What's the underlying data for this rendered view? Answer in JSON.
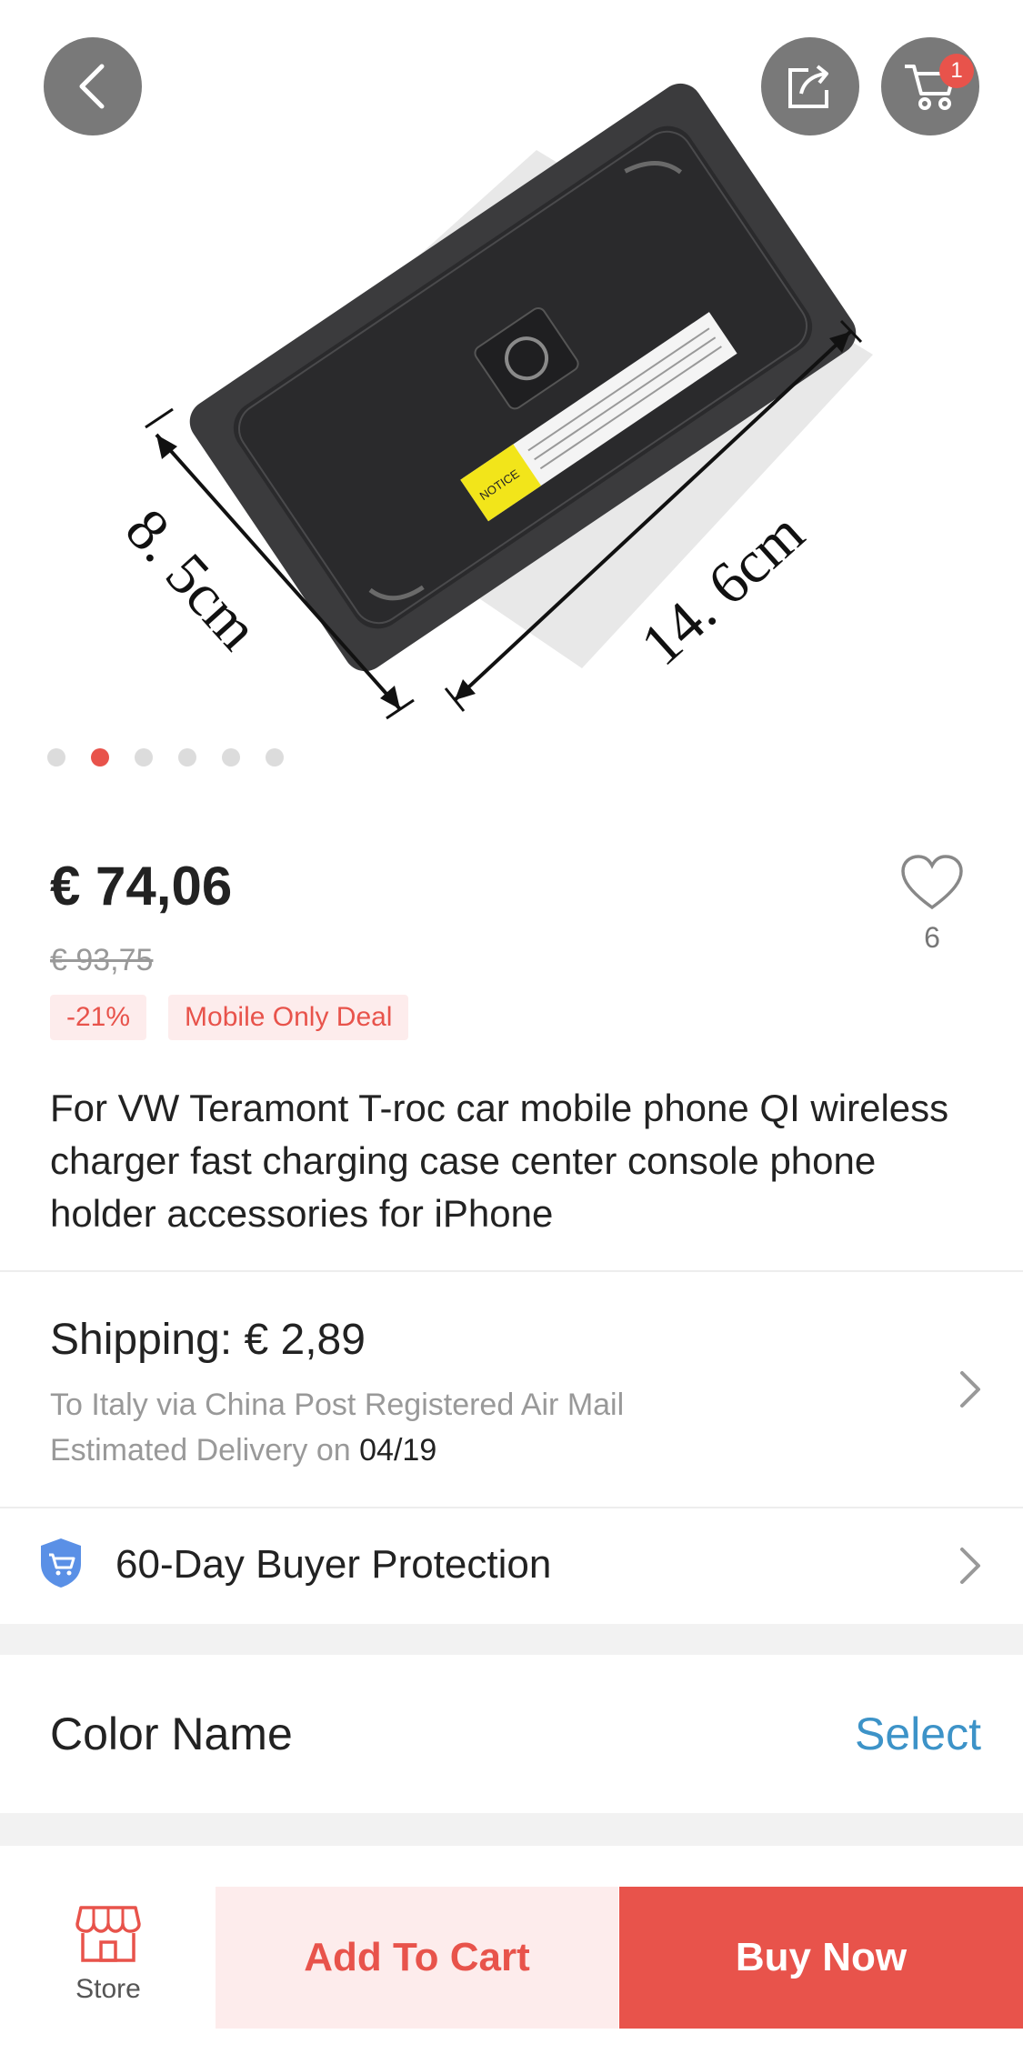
{
  "product_image": {
    "dimension_short": "8. 5cm",
    "dimension_long": "14. 6cm",
    "notice_text": "NOTICE",
    "carousel_count": 6,
    "carousel_active_index": 1
  },
  "header": {
    "cart_badge_count": "1"
  },
  "pricing": {
    "price": "€ 74,06",
    "original_price": "€ 93,75",
    "discount_badge": "-21%",
    "deal_badge": "Mobile Only Deal",
    "wishlist_count": "6"
  },
  "product": {
    "title": "For VW Teramont T-roc car mobile phone QI wireless charger fast charging case center console phone holder accessories for iPhone"
  },
  "shipping": {
    "title": "Shipping: € 2,89",
    "route": "To Italy via China Post Registered Air Mail",
    "delivery_prefix": "Estimated Delivery on",
    "delivery_date": "04/19"
  },
  "protection": {
    "label": "60-Day Buyer Protection"
  },
  "options": {
    "color_label": "Color Name",
    "select_label": "Select"
  },
  "bottom_bar": {
    "store_label": "Store",
    "add_to_cart": "Add To Cart",
    "buy_now": "Buy Now"
  },
  "colors": {
    "accent": "#e8534b",
    "accent_light": "#fdecec",
    "link": "#3d93c8",
    "protection_icon": "#4a86e8"
  }
}
